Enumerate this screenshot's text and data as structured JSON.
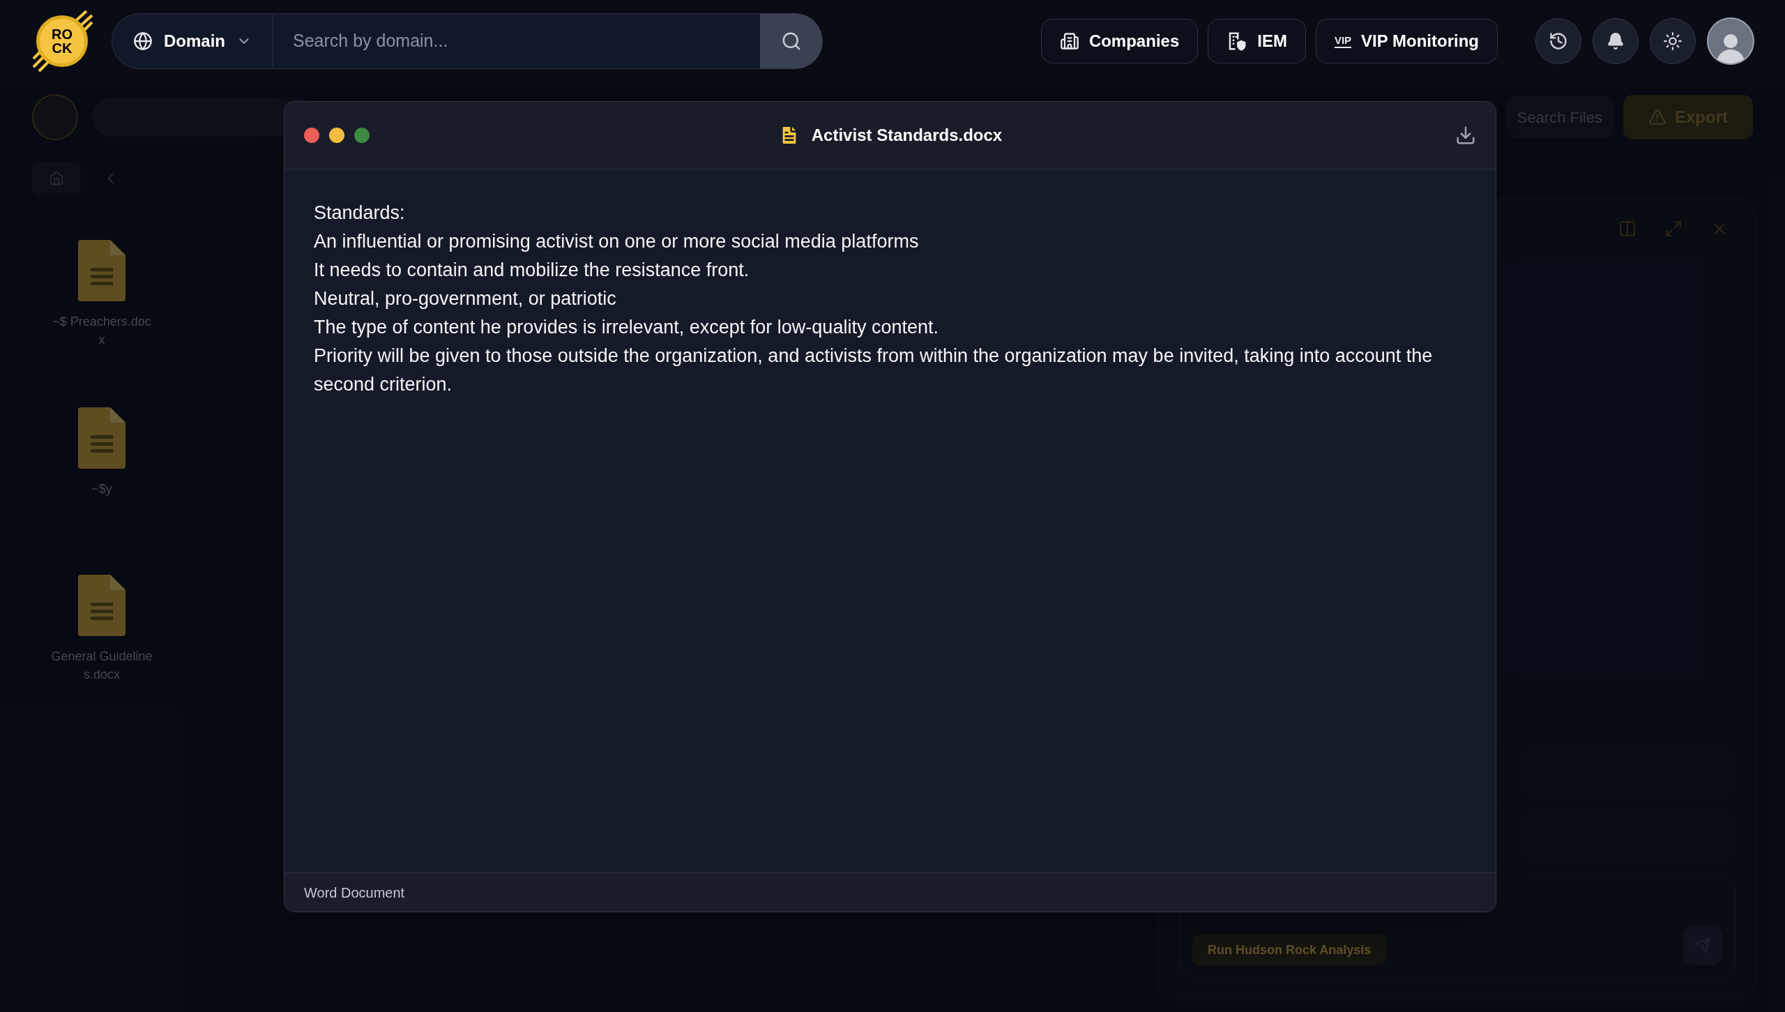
{
  "header": {
    "logo": {
      "line_1": "RO",
      "line_2": "CK"
    },
    "search_type": "Domain",
    "search": {
      "placeholder": "Search by domain..."
    },
    "nav_buttons": [
      {
        "label": "Companies",
        "kind": "companies"
      },
      {
        "label": "IEM",
        "kind": "iem"
      },
      {
        "label": "VIP Monitoring",
        "kind": "vip",
        "icon_text": "VIP"
      }
    ]
  },
  "background": {
    "toolbar": {
      "search_files": "Search Files",
      "export": "Export"
    },
    "files": [
      {
        "name": "~$ Preachers.docx"
      },
      {
        "name": "~$y"
      },
      {
        "name": "General Guidelines.docx"
      }
    ],
    "assistant": {
      "action": "Run Hudson Rock Analysis"
    }
  },
  "document": {
    "title": "Activist Standards.docx",
    "lines": [
      "Standards:",
      "An influential or promising activist on one or more social media platforms",
      "It needs to contain and mobilize the resistance front.",
      "Neutral, pro-government, or patriotic",
      "The type of content he provides is irrelevant, except for low-quality content.",
      "Priority will be given to those outside the organization, and activists from within the organization may be invited, taking into account the second criterion."
    ],
    "footer": "Word Document"
  }
}
